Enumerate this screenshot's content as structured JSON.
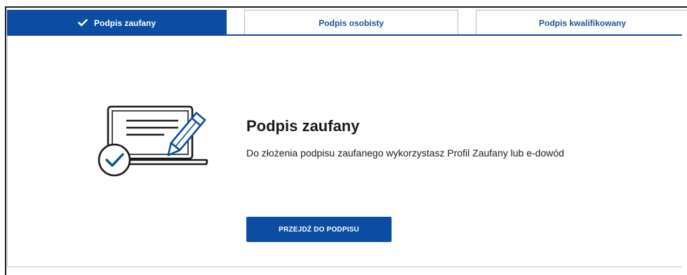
{
  "tabs": [
    {
      "label": "Podpis zaufany",
      "active": true,
      "icon": "check-icon"
    },
    {
      "label": "Podpis osobisty",
      "active": false
    },
    {
      "label": "Podpis kwalifikowany",
      "active": false
    }
  ],
  "panel": {
    "illustration_icon": "laptop-signature-icon",
    "title": "Podpis zaufany",
    "description": "Do złożenia podpisu zaufanego wykorzystasz Profil Zaufany lub e-dowód",
    "cta_label": "PRZEJDŹ DO PODPISU"
  },
  "colors": {
    "primary": "#0b4da2",
    "tab_text": "#1f4f9c",
    "text": "#1b1b1b",
    "border": "#b9b9b9"
  }
}
